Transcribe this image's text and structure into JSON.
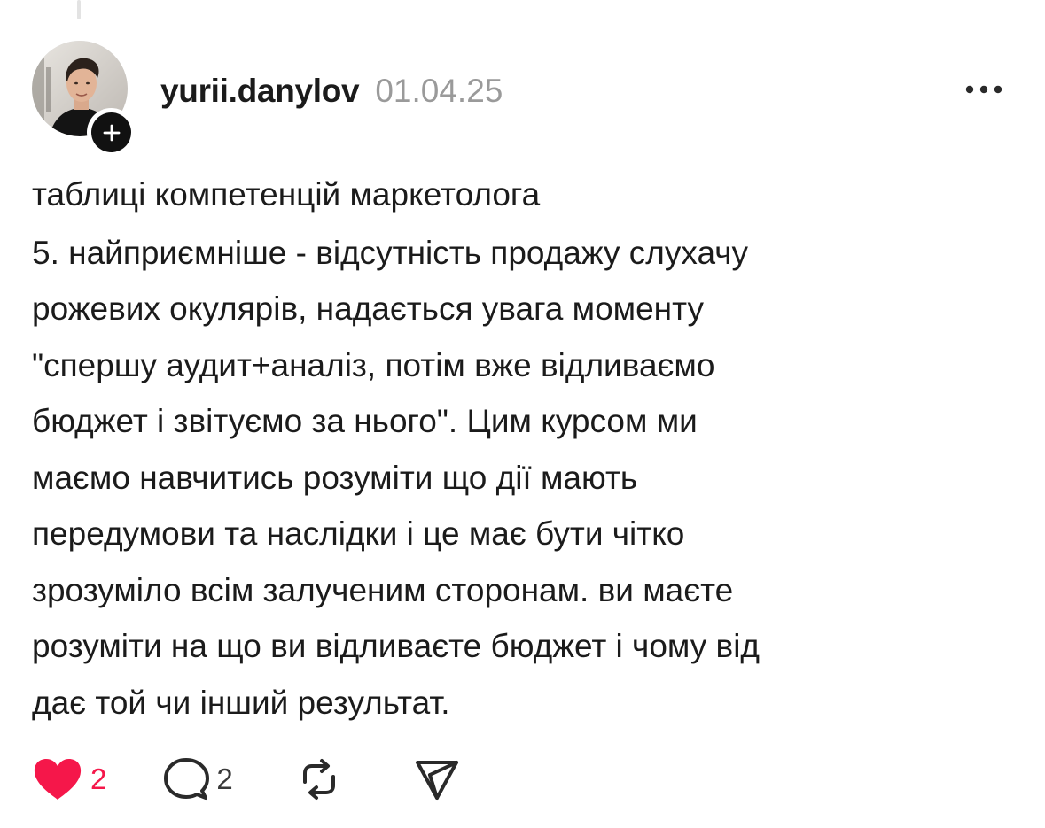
{
  "post": {
    "author": {
      "username": "yurii.danylov",
      "avatar_icon": "profile-photo",
      "follow_icon": "plus-icon"
    },
    "timestamp": "01.04.25",
    "more_icon": "ellipsis-icon",
    "lines": [
      "таблиці компетенцій маркетолога",
      "5. найприємніше - відсутність продажу слухачу",
      "рожевих окулярів, надається увага моменту",
      "\"спершу аудит+аналіз, потім вже відливаємо",
      "бюджет і звітуємо за нього\". Цим курсом ми",
      "маємо навчитись розуміти що дії мають",
      "передумови та наслідки і це має бути чітко",
      "зрозуміло всім залученим сторонам. ви маєте",
      "розуміти на що ви відливаєте бюджет і чому від",
      "дає той чи інший результат."
    ]
  },
  "actions": {
    "like": {
      "icon": "heart-icon",
      "count": "2",
      "color": "#f5174a",
      "liked": true
    },
    "reply": {
      "icon": "comment-icon",
      "count": "2"
    },
    "repost": {
      "icon": "repost-icon"
    },
    "share": {
      "icon": "send-icon"
    }
  }
}
